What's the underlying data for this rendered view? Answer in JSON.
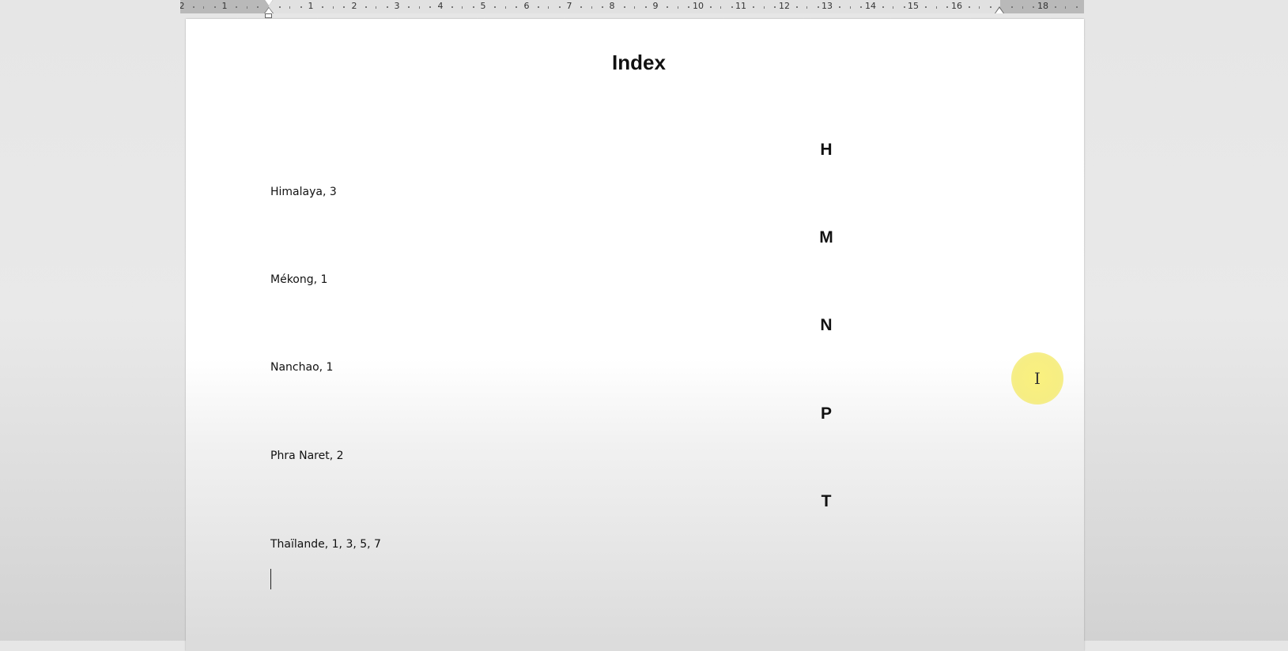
{
  "ruler": {
    "labels": [
      "2",
      "1",
      "1",
      "2",
      "3",
      "4",
      "5",
      "6",
      "7",
      "8",
      "9",
      "10",
      "11",
      "12",
      "13",
      "14",
      "15",
      "16",
      "18"
    ]
  },
  "document": {
    "title": "Index",
    "sections": [
      {
        "letter": "H",
        "entry": "Himalaya, 3"
      },
      {
        "letter": "M",
        "entry": "Mékong, 1"
      },
      {
        "letter": "N",
        "entry": "Nanchao, 1"
      },
      {
        "letter": "P",
        "entry": "Phra Naret, 2"
      },
      {
        "letter": "T",
        "entry": "Thaïlande, 1, 3, 5, 7"
      }
    ]
  },
  "cursor": {
    "icon": "i-beam-cursor-icon",
    "highlight_color": "#f5eb70"
  }
}
